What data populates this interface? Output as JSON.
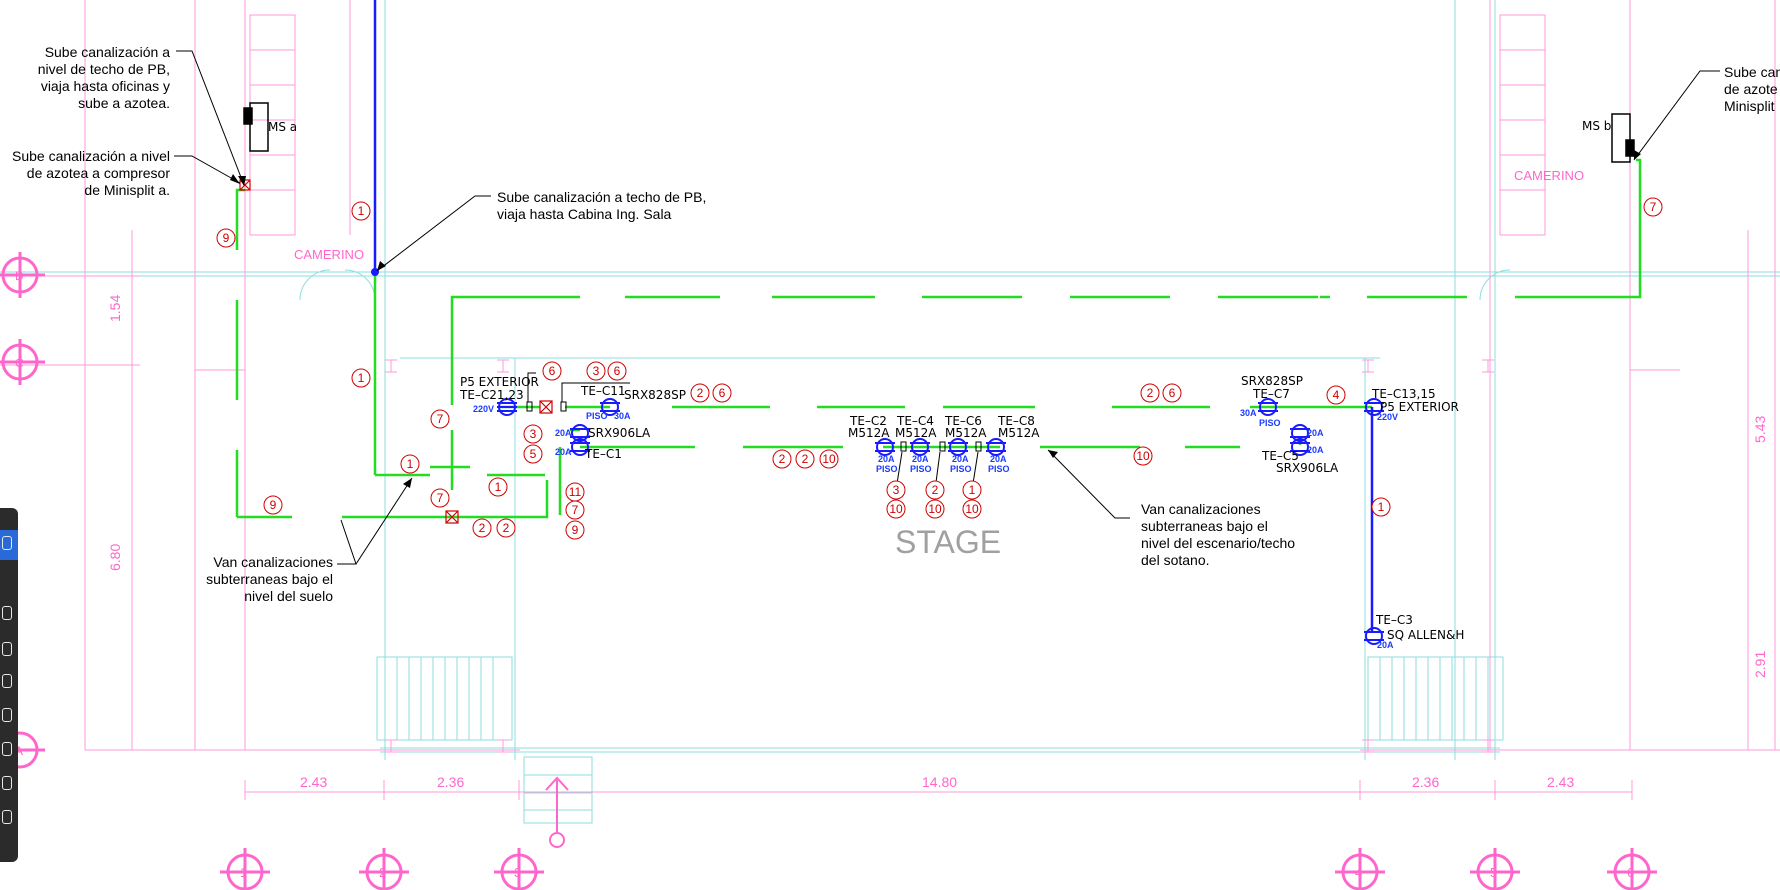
{
  "notes": {
    "n1": [
      "Sube canalización a",
      "nivel de techo de PB,",
      "viaja hasta oficinas y",
      "sube a azotea."
    ],
    "n2": [
      "Sube canalización a nivel",
      "de azotea a compresor",
      "de Minisplit a."
    ],
    "n3": [
      "Sube canalización a techo de PB,",
      "viaja hasta Cabina Ing. Sala"
    ],
    "n4": [
      "Van canalizaciones",
      "subterraneas bajo el",
      "nivel del suelo"
    ],
    "n5": [
      "Van canalizaciones",
      "subterraneas bajo el",
      "nivel del escenario/techo",
      "del sotano."
    ],
    "n6": [
      "Sube can",
      "de azote",
      "Minisplit"
    ]
  },
  "rooms": {
    "camerino_left": "CAMERINO",
    "camerino_right": "CAMERINO",
    "stage": "STAGE"
  },
  "equipment": {
    "ms_a": "MS  a",
    "ms_b": "MS  b",
    "p5_left": "P5  EXTERIOR",
    "te_c21": "TE–C21,23",
    "v220_left": "220V",
    "te_c11": "TE–C11",
    "srx828_left": "SRX828SP",
    "piso": "PISO",
    "a30": "30A",
    "a20": "20A",
    "srx906_left": "SRX906LA",
    "te_c1": "TE–C1",
    "te_c2": "TE–C2",
    "te_c4": "TE–C4",
    "te_c6": "TE–C6",
    "te_c8": "TE–C8",
    "m512": "M512A",
    "srx828_right": "SRX828SP",
    "te_c7": "TE–C7",
    "te_c13": "TE–C13,15",
    "p5_right": "P5  EXTERIOR",
    "v220_right": "220V",
    "te_c5": "TE–C5",
    "srx906_right": "SRX906LA",
    "te_c3": "TE–C3",
    "sq_allen": "SQ  ALLEN&H"
  },
  "circle_numbers": [
    "1",
    "9",
    "1",
    "7",
    "1",
    "6",
    "3",
    "6",
    "2",
    "6",
    "3",
    "5",
    "7",
    "1",
    "11",
    "2",
    "2",
    "7",
    "9",
    "9",
    "2",
    "2",
    "10",
    "3",
    "2",
    "1",
    "10",
    "10",
    "10",
    "10",
    "2",
    "6",
    "4",
    "1",
    "7"
  ],
  "dimensions": {
    "bottom": [
      "2.43",
      "2.36",
      "14.80",
      "2.36",
      "2.43"
    ],
    "left": [
      "1.54",
      "6.80"
    ],
    "right": [
      "5.43",
      "2.91"
    ]
  },
  "grid_tags": [
    "1",
    "2",
    "3",
    "4",
    "5",
    "6"
  ],
  "colors": {
    "green": "#22dd22",
    "blue": "#1a1aff",
    "pink": "#ff66cc",
    "cyan": "#7fd9d9",
    "red": "#d00000"
  }
}
